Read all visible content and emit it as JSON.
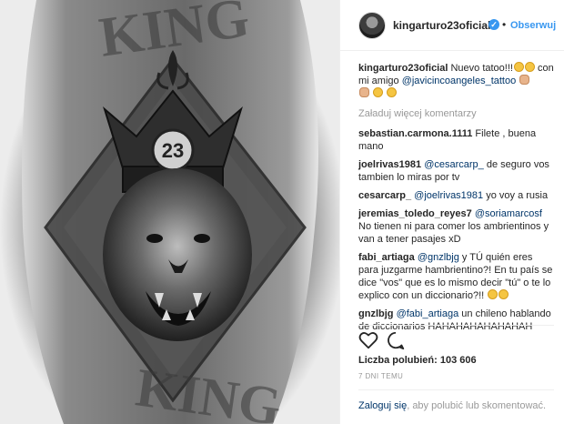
{
  "header": {
    "username": "kingarturo23oficial",
    "separator": "•",
    "follow_label": "Obserwuj"
  },
  "caption": {
    "user": "kingarturo23oficial",
    "text_before": " Nuevo tatoo!!!",
    "text_middle": " con mi amigo ",
    "mention": "@javicincoangeles_tattoo"
  },
  "load_more": "Załaduj więcej komentarzy",
  "comments": [
    {
      "user": "sebastian.carmona.1111",
      "mention": "",
      "text": " Filete , buena mano"
    },
    {
      "user": "joelrivas1981",
      "mention": "@cesarcarp_",
      "text": " de seguro vos tambien lo miras por tv"
    },
    {
      "user": "cesarcarp_",
      "mention": "@joelrivas1981",
      "text": " yo voy a rusia"
    },
    {
      "user": "jeremias_toledo_reyes7",
      "mention": "@soriamarcosf",
      "text": " No tienen ni para comer los ambrientinos y van a tener pasajes xD"
    },
    {
      "user": "fabi_artiaga",
      "mention": "@gnzlbjg",
      "text": " y TÚ quién eres para juzgarme hambrientino?! En tu país se dice \"vos\" que es lo mismo decir \"tú\" o te lo explico con un diccionario?!! "
    },
    {
      "user": "gnzlbjg",
      "mention": "@fabi_artiaga",
      "text": " un chileno hablando de diccionarios HAHAHAHAHAHAHAH"
    }
  ],
  "likes_label": "Liczba polubień: 103 606",
  "time_label": "7 DNI TEMU",
  "login": {
    "link": "Zaloguj się",
    "text": ", aby polubić lub skomentować."
  },
  "photo": {
    "crown_number": "23",
    "tattoo_text_top": "KING",
    "tattoo_text_bottom": "KING"
  },
  "colors": {
    "link": "#003569",
    "accent": "#3897f0",
    "muted": "#999999",
    "text": "#262626"
  },
  "icons": {
    "like": "heart-icon",
    "comment": "speech-bubble-icon",
    "verified": "verified-badge-icon"
  }
}
